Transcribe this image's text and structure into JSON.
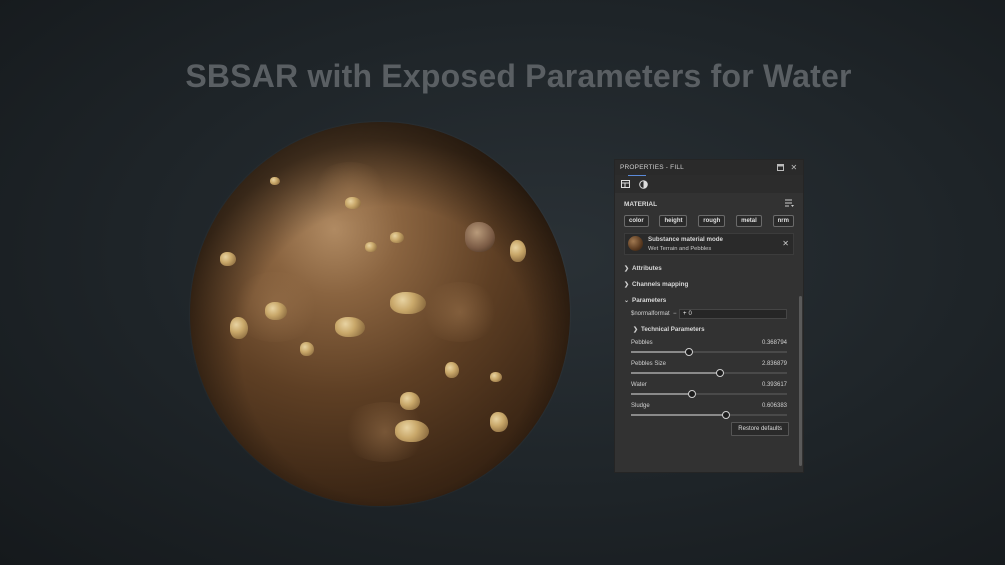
{
  "headline": "SBSAR with Exposed Parameters for Water",
  "panel": {
    "title": "PROPERTIES - FILL",
    "section_title": "MATERIAL",
    "channels": [
      "color",
      "height",
      "rough",
      "metal",
      "nrm"
    ],
    "mode": {
      "title": "Substance material mode",
      "subtitle": "Wet Terrain and Pebbles"
    },
    "collapsibles": {
      "attributes": "Attributes",
      "channels_mapping": "Channels mapping",
      "parameters": "Parameters"
    },
    "normalformat": {
      "label": "$normalformat",
      "value": "0"
    },
    "technical": "Technical Parameters",
    "params": [
      {
        "name": "Pebbles",
        "value": "0.368794",
        "fraction": 0.37
      },
      {
        "name": "Pebbles Size",
        "value": "2.836879",
        "fraction": 0.57
      },
      {
        "name": "Water",
        "value": "0.393617",
        "fraction": 0.39
      },
      {
        "name": "Sludge",
        "value": "0.606383",
        "fraction": 0.61
      }
    ],
    "restore_label": "Restore defaults"
  }
}
